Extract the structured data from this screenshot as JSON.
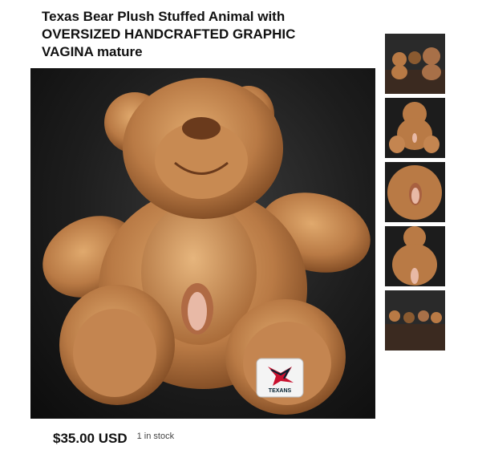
{
  "listing": {
    "title": "Texas Bear Plush Stuffed Animal with\nOVERSIZED HANDCRAFTED GRAPHIC\nVAGINA mature",
    "price": "$35.00 USD",
    "stock": "1 in stock",
    "badge_text": "TEXANS"
  },
  "thumbnails": [
    {
      "name": "bears-on-couch"
    },
    {
      "name": "bear-front"
    },
    {
      "name": "bear-closeup"
    },
    {
      "name": "bear-closeup-2"
    },
    {
      "name": "bears-on-couch-2"
    }
  ],
  "colors": {
    "plush": "#b97a45",
    "plush_light": "#d59a5f",
    "plush_dark": "#7a4620",
    "background": "#1b1b1b",
    "badge_red": "#c8102e",
    "badge_navy": "#03202f"
  }
}
